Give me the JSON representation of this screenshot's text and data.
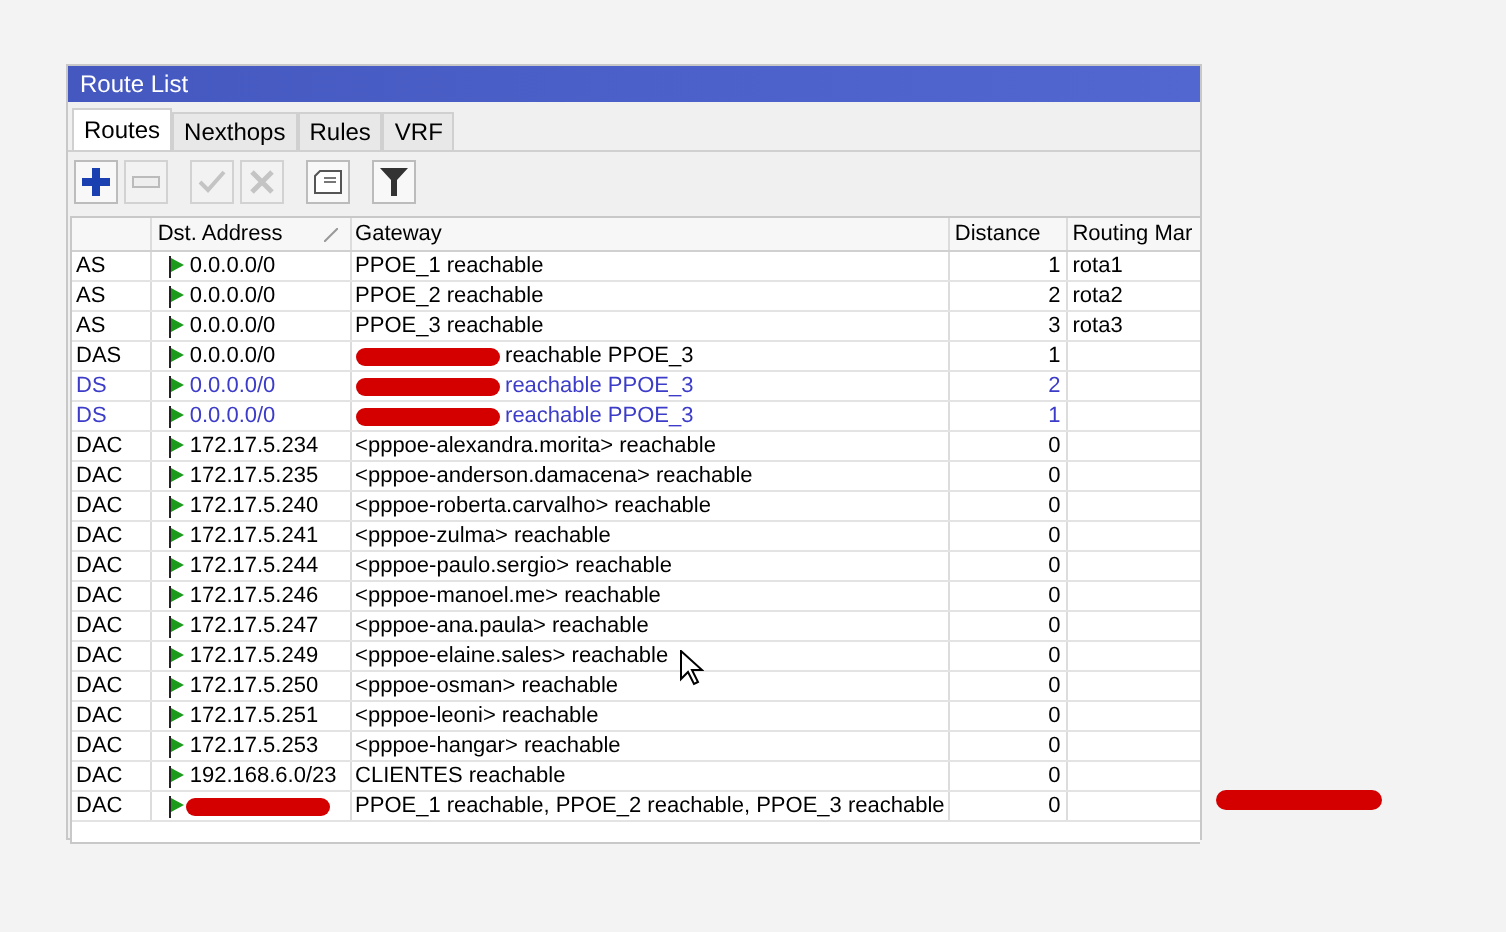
{
  "window": {
    "title": "Route List"
  },
  "tabs": [
    {
      "label": "Routes",
      "selected": true
    },
    {
      "label": "Nexthops",
      "selected": false
    },
    {
      "label": "Rules",
      "selected": false
    },
    {
      "label": "VRF",
      "selected": false
    }
  ],
  "toolbar": [
    {
      "kind": "add",
      "disabled": false
    },
    {
      "kind": "remove",
      "disabled": true
    },
    {
      "kind": "enable",
      "disabled": true
    },
    {
      "kind": "disable",
      "disabled": true
    },
    {
      "kind": "comment",
      "disabled": false
    },
    {
      "kind": "filter",
      "disabled": false
    }
  ],
  "table": {
    "columns": [
      {
        "label": "Dst. Address",
        "sorted": true
      },
      {
        "label": "Gateway",
        "sorted": false
      },
      {
        "label": "Distance",
        "sorted": false
      },
      {
        "label": "Routing Mar",
        "sorted": false
      }
    ],
    "rows": [
      {
        "flags": "AS",
        "dst": "0.0.0.0/0",
        "gateway": "PPOE_1 reachable",
        "gateway_redacted": false,
        "distance": "1",
        "routing_mark": "rota1",
        "color": "#000000"
      },
      {
        "flags": "AS",
        "dst": "0.0.0.0/0",
        "gateway": "PPOE_2 reachable",
        "gateway_redacted": false,
        "distance": "2",
        "routing_mark": "rota2",
        "color": "#000000"
      },
      {
        "flags": "AS",
        "dst": "0.0.0.0/0",
        "gateway": "PPOE_3 reachable",
        "gateway_redacted": false,
        "distance": "3",
        "routing_mark": "rota3",
        "color": "#000000"
      },
      {
        "flags": "DAS",
        "dst": "0.0.0.0/0",
        "gateway": "reachable PPOE_3",
        "gateway_redacted": true,
        "distance": "1",
        "color": "#000000"
      },
      {
        "flags": "DS",
        "dst": "0.0.0.0/0",
        "gateway": "reachable PPOE_3",
        "gateway_redacted": true,
        "distance": "2",
        "color": "#3c3cc8"
      },
      {
        "flags": "DS",
        "dst": "0.0.0.0/0",
        "gateway": "reachable PPOE_3",
        "gateway_redacted": true,
        "distance": "1",
        "color": "#3c3cc8"
      },
      {
        "flags": "DAC",
        "dst": "172.17.5.234",
        "gateway": "<pppoe-alexandra.morita> reachable",
        "gateway_redacted": false,
        "distance": "0",
        "color": "#000000"
      },
      {
        "flags": "DAC",
        "dst": "172.17.5.235",
        "gateway": "<pppoe-anderson.damacena> reachable",
        "gateway_redacted": false,
        "distance": "0",
        "color": "#000000"
      },
      {
        "flags": "DAC",
        "dst": "172.17.5.240",
        "gateway": "<pppoe-roberta.carvalho> reachable",
        "gateway_redacted": false,
        "distance": "0",
        "color": "#000000"
      },
      {
        "flags": "DAC",
        "dst": "172.17.5.241",
        "gateway": "<pppoe-zulma> reachable",
        "gateway_redacted": false,
        "distance": "0",
        "color": "#000000"
      },
      {
        "flags": "DAC",
        "dst": "172.17.5.244",
        "gateway": "<pppoe-paulo.sergio> reachable",
        "gateway_redacted": false,
        "distance": "0",
        "color": "#000000"
      },
      {
        "flags": "DAC",
        "dst": "172.17.5.246",
        "gateway": "<pppoe-manoel.me> reachable",
        "gateway_redacted": false,
        "distance": "0",
        "color": "#000000"
      },
      {
        "flags": "DAC",
        "dst": "172.17.5.247",
        "gateway": "<pppoe-ana.paula> reachable",
        "gateway_redacted": false,
        "distance": "0",
        "color": "#000000"
      },
      {
        "flags": "DAC",
        "dst": "172.17.5.249",
        "gateway": "<pppoe-elaine.sales> reachable",
        "gateway_redacted": false,
        "distance": "0",
        "color": "#000000"
      },
      {
        "flags": "DAC",
        "dst": "172.17.5.250",
        "gateway": "<pppoe-osman> reachable",
        "gateway_redacted": false,
        "distance": "0",
        "color": "#000000"
      },
      {
        "flags": "DAC",
        "dst": "172.17.5.251",
        "gateway": "<pppoe-leoni> reachable",
        "gateway_redacted": false,
        "distance": "0",
        "color": "#000000"
      },
      {
        "flags": "DAC",
        "dst": "172.17.5.253",
        "gateway": "<pppoe-hangar> reachable",
        "gateway_redacted": false,
        "distance": "0",
        "color": "#000000"
      },
      {
        "flags": "DAC",
        "dst": "192.168.6.0/23",
        "gateway": "CLIENTES reachable",
        "gateway_redacted": false,
        "distance": "0",
        "color": "#000000"
      },
      {
        "flags": "DAC",
        "dst_redacted": true,
        "gateway": "PPOE_1 reachable, PPOE_2 reachable, PPOE_3 reachable",
        "gateway_redacted": false,
        "distance": "0",
        "color": "#000000"
      }
    ]
  },
  "background_redaction": true
}
